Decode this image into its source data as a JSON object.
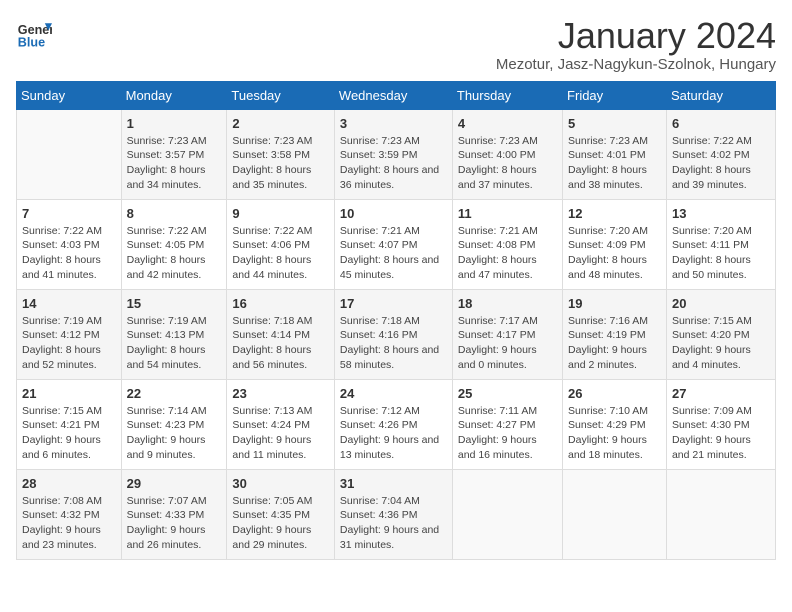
{
  "logo": {
    "line1": "General",
    "line2": "Blue"
  },
  "calendar": {
    "title": "January 2024",
    "subtitle": "Mezotur, Jasz-Nagykun-Szolnok, Hungary"
  },
  "weekdays": [
    "Sunday",
    "Monday",
    "Tuesday",
    "Wednesday",
    "Thursday",
    "Friday",
    "Saturday"
  ],
  "weeks": [
    [
      {
        "day": "",
        "sunrise": "",
        "sunset": "",
        "daylight": ""
      },
      {
        "day": "1",
        "sunrise": "Sunrise: 7:23 AM",
        "sunset": "Sunset: 3:57 PM",
        "daylight": "Daylight: 8 hours and 34 minutes."
      },
      {
        "day": "2",
        "sunrise": "Sunrise: 7:23 AM",
        "sunset": "Sunset: 3:58 PM",
        "daylight": "Daylight: 8 hours and 35 minutes."
      },
      {
        "day": "3",
        "sunrise": "Sunrise: 7:23 AM",
        "sunset": "Sunset: 3:59 PM",
        "daylight": "Daylight: 8 hours and 36 minutes."
      },
      {
        "day": "4",
        "sunrise": "Sunrise: 7:23 AM",
        "sunset": "Sunset: 4:00 PM",
        "daylight": "Daylight: 8 hours and 37 minutes."
      },
      {
        "day": "5",
        "sunrise": "Sunrise: 7:23 AM",
        "sunset": "Sunset: 4:01 PM",
        "daylight": "Daylight: 8 hours and 38 minutes."
      },
      {
        "day": "6",
        "sunrise": "Sunrise: 7:22 AM",
        "sunset": "Sunset: 4:02 PM",
        "daylight": "Daylight: 8 hours and 39 minutes."
      }
    ],
    [
      {
        "day": "7",
        "sunrise": "Sunrise: 7:22 AM",
        "sunset": "Sunset: 4:03 PM",
        "daylight": "Daylight: 8 hours and 41 minutes."
      },
      {
        "day": "8",
        "sunrise": "Sunrise: 7:22 AM",
        "sunset": "Sunset: 4:05 PM",
        "daylight": "Daylight: 8 hours and 42 minutes."
      },
      {
        "day": "9",
        "sunrise": "Sunrise: 7:22 AM",
        "sunset": "Sunset: 4:06 PM",
        "daylight": "Daylight: 8 hours and 44 minutes."
      },
      {
        "day": "10",
        "sunrise": "Sunrise: 7:21 AM",
        "sunset": "Sunset: 4:07 PM",
        "daylight": "Daylight: 8 hours and 45 minutes."
      },
      {
        "day": "11",
        "sunrise": "Sunrise: 7:21 AM",
        "sunset": "Sunset: 4:08 PM",
        "daylight": "Daylight: 8 hours and 47 minutes."
      },
      {
        "day": "12",
        "sunrise": "Sunrise: 7:20 AM",
        "sunset": "Sunset: 4:09 PM",
        "daylight": "Daylight: 8 hours and 48 minutes."
      },
      {
        "day": "13",
        "sunrise": "Sunrise: 7:20 AM",
        "sunset": "Sunset: 4:11 PM",
        "daylight": "Daylight: 8 hours and 50 minutes."
      }
    ],
    [
      {
        "day": "14",
        "sunrise": "Sunrise: 7:19 AM",
        "sunset": "Sunset: 4:12 PM",
        "daylight": "Daylight: 8 hours and 52 minutes."
      },
      {
        "day": "15",
        "sunrise": "Sunrise: 7:19 AM",
        "sunset": "Sunset: 4:13 PM",
        "daylight": "Daylight: 8 hours and 54 minutes."
      },
      {
        "day": "16",
        "sunrise": "Sunrise: 7:18 AM",
        "sunset": "Sunset: 4:14 PM",
        "daylight": "Daylight: 8 hours and 56 minutes."
      },
      {
        "day": "17",
        "sunrise": "Sunrise: 7:18 AM",
        "sunset": "Sunset: 4:16 PM",
        "daylight": "Daylight: 8 hours and 58 minutes."
      },
      {
        "day": "18",
        "sunrise": "Sunrise: 7:17 AM",
        "sunset": "Sunset: 4:17 PM",
        "daylight": "Daylight: 9 hours and 0 minutes."
      },
      {
        "day": "19",
        "sunrise": "Sunrise: 7:16 AM",
        "sunset": "Sunset: 4:19 PM",
        "daylight": "Daylight: 9 hours and 2 minutes."
      },
      {
        "day": "20",
        "sunrise": "Sunrise: 7:15 AM",
        "sunset": "Sunset: 4:20 PM",
        "daylight": "Daylight: 9 hours and 4 minutes."
      }
    ],
    [
      {
        "day": "21",
        "sunrise": "Sunrise: 7:15 AM",
        "sunset": "Sunset: 4:21 PM",
        "daylight": "Daylight: 9 hours and 6 minutes."
      },
      {
        "day": "22",
        "sunrise": "Sunrise: 7:14 AM",
        "sunset": "Sunset: 4:23 PM",
        "daylight": "Daylight: 9 hours and 9 minutes."
      },
      {
        "day": "23",
        "sunrise": "Sunrise: 7:13 AM",
        "sunset": "Sunset: 4:24 PM",
        "daylight": "Daylight: 9 hours and 11 minutes."
      },
      {
        "day": "24",
        "sunrise": "Sunrise: 7:12 AM",
        "sunset": "Sunset: 4:26 PM",
        "daylight": "Daylight: 9 hours and 13 minutes."
      },
      {
        "day": "25",
        "sunrise": "Sunrise: 7:11 AM",
        "sunset": "Sunset: 4:27 PM",
        "daylight": "Daylight: 9 hours and 16 minutes."
      },
      {
        "day": "26",
        "sunrise": "Sunrise: 7:10 AM",
        "sunset": "Sunset: 4:29 PM",
        "daylight": "Daylight: 9 hours and 18 minutes."
      },
      {
        "day": "27",
        "sunrise": "Sunrise: 7:09 AM",
        "sunset": "Sunset: 4:30 PM",
        "daylight": "Daylight: 9 hours and 21 minutes."
      }
    ],
    [
      {
        "day": "28",
        "sunrise": "Sunrise: 7:08 AM",
        "sunset": "Sunset: 4:32 PM",
        "daylight": "Daylight: 9 hours and 23 minutes."
      },
      {
        "day": "29",
        "sunrise": "Sunrise: 7:07 AM",
        "sunset": "Sunset: 4:33 PM",
        "daylight": "Daylight: 9 hours and 26 minutes."
      },
      {
        "day": "30",
        "sunrise": "Sunrise: 7:05 AM",
        "sunset": "Sunset: 4:35 PM",
        "daylight": "Daylight: 9 hours and 29 minutes."
      },
      {
        "day": "31",
        "sunrise": "Sunrise: 7:04 AM",
        "sunset": "Sunset: 4:36 PM",
        "daylight": "Daylight: 9 hours and 31 minutes."
      },
      {
        "day": "",
        "sunrise": "",
        "sunset": "",
        "daylight": ""
      },
      {
        "day": "",
        "sunrise": "",
        "sunset": "",
        "daylight": ""
      },
      {
        "day": "",
        "sunrise": "",
        "sunset": "",
        "daylight": ""
      }
    ]
  ]
}
